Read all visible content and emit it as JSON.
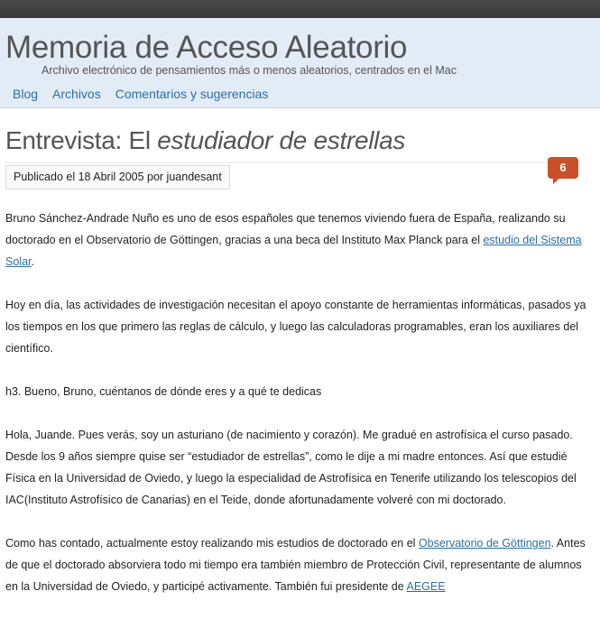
{
  "site": {
    "title": "Memoria de Acceso Aleatorio",
    "description": "Archivo electrónico de pensamientos más o menos aleatorios, centrados en el Mac"
  },
  "nav": {
    "items": [
      {
        "label": "Blog"
      },
      {
        "label": "Archivos"
      },
      {
        "label": "Comentarios y sugerencias"
      }
    ]
  },
  "post": {
    "title_prefix": "Entrevista: El ",
    "title_emphasis": "estudiador de estrellas",
    "meta": "Publicado el 18 Abril 2005 por juandesant",
    "comment_count": "6",
    "paragraphs": {
      "p1_text": "Bruno Sánchez-Andrade Nuño es uno de esos españoles que tenemos viviendo fuera de España, realizando su doctorado en el Observatorio de Göttingen, gracias a una beca del Instituto Max Planck para el ",
      "p1_link": "estudio del Sistema Solar",
      "p1_end": ".",
      "p2": "Hoy en día, las actividades de investigación necesitan el apoyo constante de herramientas informáticas, pasados ya los tiempos en los que primero las reglas de cálculo, y luego las calculadoras programables, eran los auxiliares del científico.",
      "p3": "h3. Bueno, Bruno, cuéntanos de dónde eres y a qué te dedicas",
      "p4": "Hola, Juande. Pues verás, soy un asturiano (de nacimiento y corazón). Me gradué en astrofísica el curso pasado. Desde los 9 años siempre quise ser “estudiador de estrellas”, como le dije a mi madre entonces. Así que estudié Física en la Universidad de Oviedo, y luego la especialidad de Astrofísica en Tenerife utilizando los telescopios del IAC(Instituto Astrofísico de Canarias) en el Teide, donde afortunadamente volveré con mi doctorado.",
      "p5_text": "Como has contado, actualmente estoy realizando mis estudios de doctorado en el ",
      "p5_link": "Observatorio de Göttingen",
      "p5_text2": ". Antes de que el doctorado absorviera todo mi tiempo era también miembro de Protección Civil, representante de ",
      "p5_text3": "alumnos en la Universidad de Oviedo, y participé activamente. También fui presidente de ",
      "p5_link2": "AEGEE"
    }
  }
}
